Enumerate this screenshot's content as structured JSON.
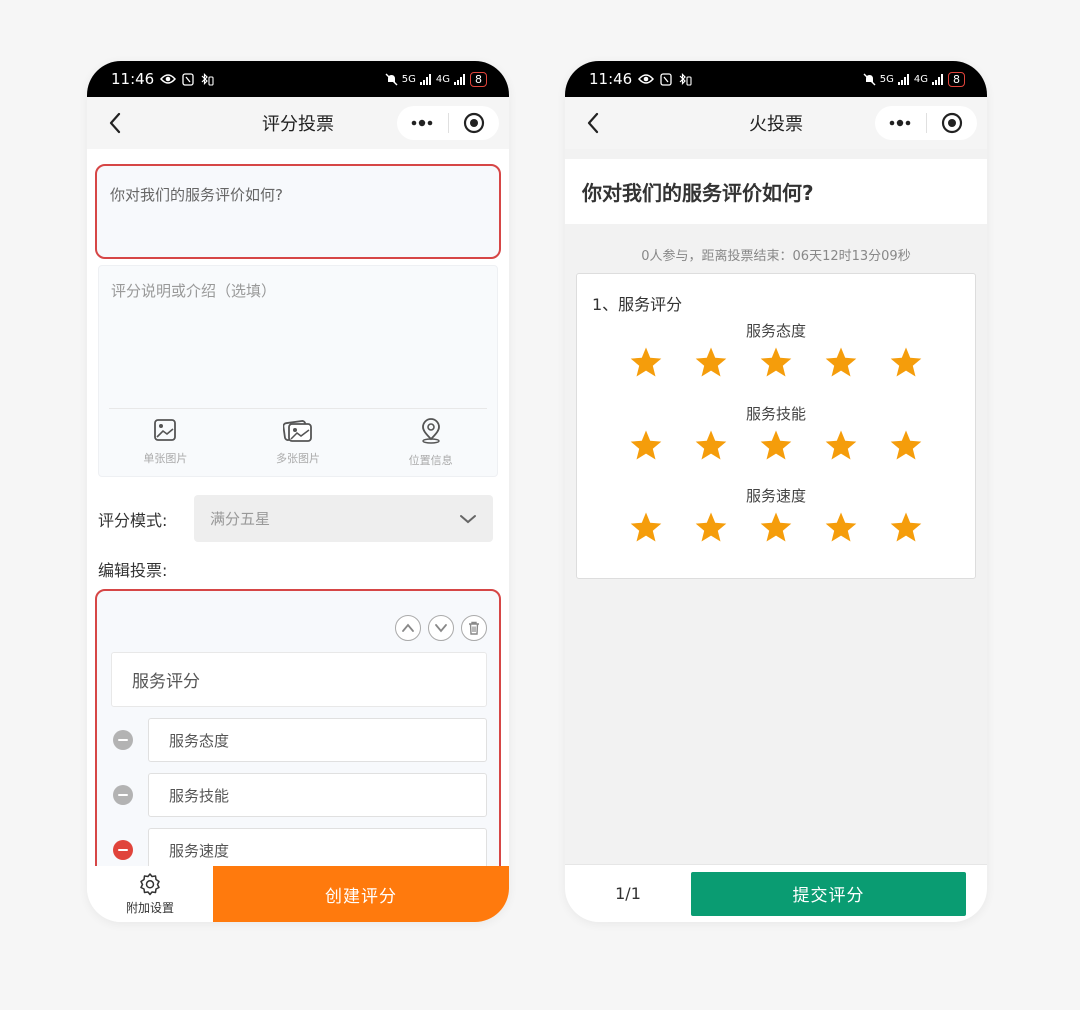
{
  "status_bar": {
    "time": "11:46",
    "battery": "8",
    "network_1": "5G",
    "network_2": "4G"
  },
  "left": {
    "nav_title": "评分投票",
    "question_text": "你对我们的服务评价如何?",
    "description_placeholder": "评分说明或介绍（选填）",
    "media": [
      {
        "label": "单张图片",
        "icon": "image-icon"
      },
      {
        "label": "多张图片",
        "icon": "images-icon"
      },
      {
        "label": "位置信息",
        "icon": "location-icon"
      }
    ],
    "mode_label": "评分模式:",
    "mode_value": "满分五星",
    "edit_label": "编辑投票:",
    "item_title": "服务评分",
    "options": [
      "服务态度",
      "服务技能",
      "服务速度"
    ],
    "extra_settings_label": "附加设置",
    "create_button": "创建评分"
  },
  "right": {
    "nav_title": "火投票",
    "question_title": "你对我们的服务评价如何?",
    "meta": "0人参与，距离投票结束：06天12时13分09秒",
    "card_title": "1、服务评分",
    "items": [
      {
        "label": "服务态度",
        "stars": 5
      },
      {
        "label": "服务技能",
        "stars": 5
      },
      {
        "label": "服务速度",
        "stars": 5
      }
    ],
    "pager": "1/1",
    "submit_button": "提交评分"
  },
  "colors": {
    "highlight_border": "#d64646",
    "create_button": "#ff7a0d",
    "submit_button": "#0a9c72",
    "star": "#f59d0b"
  }
}
